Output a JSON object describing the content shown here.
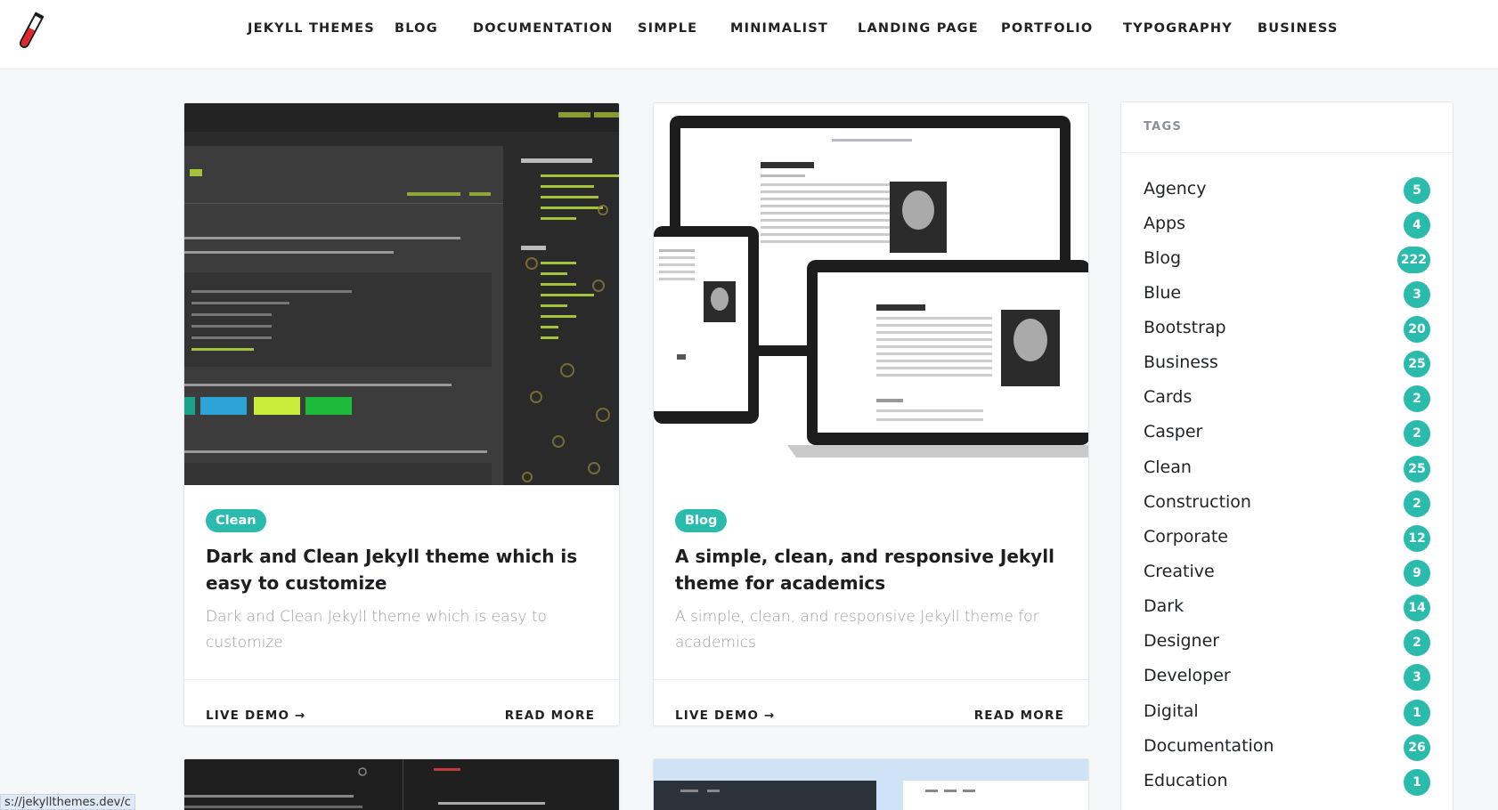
{
  "nav": {
    "logo_icon": "test-tube-icon",
    "items": [
      {
        "label": "JEKYLL THEMES"
      },
      {
        "label": "BLOG"
      },
      {
        "label": "DOCUMENTATION"
      },
      {
        "label": "SIMPLE"
      },
      {
        "label": "MINIMALIST"
      },
      {
        "label": "LANDING PAGE"
      },
      {
        "label": "PORTFOLIO"
      },
      {
        "label": "TYPOGRAPHY"
      },
      {
        "label": "BUSINESS"
      }
    ]
  },
  "cards": [
    {
      "tag": "Clean",
      "title": "Dark and Clean Jekyll theme which is easy to customize",
      "description": "Dark and Clean Jekyll theme which is easy to customize",
      "live_demo": "LIVE DEMO →",
      "read_more": "READ MORE"
    },
    {
      "tag": "Blog",
      "title": "A simple, clean, and responsive Jekyll theme for academics",
      "description": "A simple, clean, and responsive Jekyll theme for academics",
      "live_demo": "LIVE DEMO →",
      "read_more": "READ MORE"
    }
  ],
  "sidebar": {
    "heading": "TAGS",
    "tags": [
      {
        "name": "Agency",
        "count": "5"
      },
      {
        "name": "Apps",
        "count": "4"
      },
      {
        "name": "Blog",
        "count": "222"
      },
      {
        "name": "Blue",
        "count": "3"
      },
      {
        "name": "Bootstrap",
        "count": "20"
      },
      {
        "name": "Business",
        "count": "25"
      },
      {
        "name": "Cards",
        "count": "2"
      },
      {
        "name": "Casper",
        "count": "2"
      },
      {
        "name": "Clean",
        "count": "25"
      },
      {
        "name": "Construction",
        "count": "2"
      },
      {
        "name": "Corporate",
        "count": "12"
      },
      {
        "name": "Creative",
        "count": "9"
      },
      {
        "name": "Dark",
        "count": "14"
      },
      {
        "name": "Designer",
        "count": "2"
      },
      {
        "name": "Developer",
        "count": "3"
      },
      {
        "name": "Digital",
        "count": "1"
      },
      {
        "name": "Documentation",
        "count": "26"
      },
      {
        "name": "Education",
        "count": "1"
      }
    ]
  },
  "status_bar": {
    "url": "s://jekyllthemes.dev/c"
  },
  "colors": {
    "accent": "#2bbbad",
    "background": "#f6f7f8"
  }
}
